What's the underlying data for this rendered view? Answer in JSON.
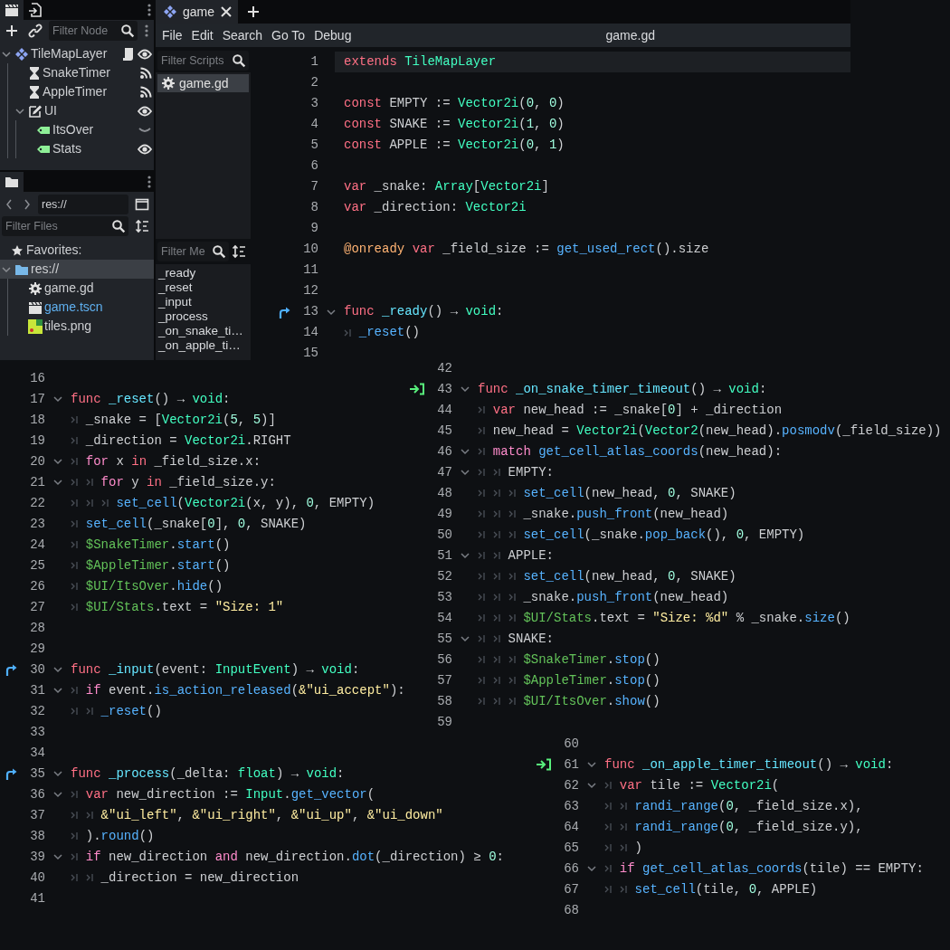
{
  "scene_dock": {
    "filter_placeholder": "Filter Node",
    "nodes": [
      {
        "name": "TileMapLayer",
        "kind": "tilemap",
        "expanded": true,
        "script": true,
        "signals": false,
        "visible": true,
        "children": [
          {
            "name": "SnakeTimer",
            "kind": "timer",
            "script": false,
            "signals": true
          },
          {
            "name": "AppleTimer",
            "kind": "timer",
            "script": false,
            "signals": true
          },
          {
            "name": "UI",
            "kind": "control",
            "expanded": true,
            "script": false,
            "signals": false,
            "visible": true,
            "children": [
              {
                "name": "ItsOver",
                "kind": "label",
                "script": false,
                "signals": false,
                "visible": false
              },
              {
                "name": "Stats",
                "kind": "label",
                "script": false,
                "signals": false,
                "visible": true
              }
            ]
          }
        ]
      }
    ]
  },
  "filesystem": {
    "path": "res://",
    "filter_placeholder": "Filter Files",
    "favorites_label": "Favorites:",
    "items": [
      {
        "name": "res://",
        "kind": "folder",
        "selected": true,
        "expanded": true,
        "current": false,
        "children": [
          {
            "name": "game.gd",
            "kind": "script",
            "selected": false,
            "current": false
          },
          {
            "name": "game.tscn",
            "kind": "scene",
            "selected": false,
            "current": true
          },
          {
            "name": "tiles.png",
            "kind": "image",
            "selected": false,
            "current": false
          }
        ]
      }
    ]
  },
  "script_editor": {
    "tabs": [
      {
        "label": "game",
        "selected": true
      }
    ],
    "menu": [
      "File",
      "Edit",
      "Search",
      "Go To",
      "Debug"
    ],
    "title": "game.gd",
    "scripts_filter_placeholder": "Filter Scripts",
    "scripts": [
      {
        "name": "game.gd",
        "selected": true
      }
    ],
    "methods_filter_placeholder": "Filter Me",
    "methods": [
      "_ready",
      "_reset",
      "_input",
      "_process",
      "_on_snake_ti…",
      "_on_apple_ti…"
    ]
  },
  "code_views": [
    {
      "lines": [
        {
          "n": "1",
          "fold": false,
          "current": true,
          "t": [
            {
              "kind": "kw",
              "text": "extends "
            },
            {
              "kind": "type",
              "text": "TileMapLayer"
            }
          ]
        },
        {
          "n": "2",
          "fold": false
        },
        {
          "n": "3",
          "fold": false,
          "t": [
            {
              "kind": "kw",
              "text": "const"
            },
            {
              "kind": "plain",
              "text": " EMPTY := "
            },
            {
              "kind": "type",
              "text": "Vector2i"
            },
            {
              "kind": "plain",
              "text": "("
            },
            {
              "kind": "num",
              "text": "0"
            },
            {
              "kind": "plain",
              "text": ", "
            },
            {
              "kind": "num",
              "text": "0"
            },
            {
              "kind": "plain",
              "text": ")"
            }
          ]
        },
        {
          "n": "4",
          "fold": false,
          "t": [
            {
              "kind": "kw",
              "text": "const"
            },
            {
              "kind": "plain",
              "text": " SNAKE := "
            },
            {
              "kind": "type",
              "text": "Vector2i"
            },
            {
              "kind": "plain",
              "text": "("
            },
            {
              "kind": "num",
              "text": "1"
            },
            {
              "kind": "plain",
              "text": ", "
            },
            {
              "kind": "num",
              "text": "0"
            },
            {
              "kind": "plain",
              "text": ")"
            }
          ]
        },
        {
          "n": "5",
          "fold": false,
          "t": [
            {
              "kind": "kw",
              "text": "const"
            },
            {
              "kind": "plain",
              "text": " APPLE := "
            },
            {
              "kind": "type",
              "text": "Vector2i"
            },
            {
              "kind": "plain",
              "text": "("
            },
            {
              "kind": "num",
              "text": "0"
            },
            {
              "kind": "plain",
              "text": ", "
            },
            {
              "kind": "num",
              "text": "1"
            },
            {
              "kind": "plain",
              "text": ")"
            }
          ]
        },
        {
          "n": "6",
          "fold": false
        },
        {
          "n": "7",
          "fold": false,
          "t": [
            {
              "kind": "kw",
              "text": "var"
            },
            {
              "kind": "plain",
              "text": " _snake: "
            },
            {
              "kind": "type",
              "text": "Array"
            },
            {
              "kind": "plain",
              "text": "["
            },
            {
              "kind": "type",
              "text": "Vector2i"
            },
            {
              "kind": "plain",
              "text": "]"
            }
          ]
        },
        {
          "n": "8",
          "fold": false,
          "t": [
            {
              "kind": "kw",
              "text": "var"
            },
            {
              "kind": "plain",
              "text": " _direction: "
            },
            {
              "kind": "type",
              "text": "Vector2i"
            }
          ]
        },
        {
          "n": "9",
          "fold": false
        },
        {
          "n": "10",
          "fold": false,
          "t": [
            {
              "kind": "annot",
              "text": "@onready "
            },
            {
              "kind": "kw",
              "text": "var"
            },
            {
              "kind": "plain",
              "text": " _field_size := "
            },
            {
              "kind": "call",
              "text": "get_used_rect"
            },
            {
              "kind": "plain",
              "text": "().size"
            }
          ]
        },
        {
          "n": "11",
          "fold": false
        },
        {
          "n": "12",
          "fold": false
        },
        {
          "n": "13",
          "fold": true,
          "gutter": {
            "kind": "override"
          },
          "t": [
            {
              "kind": "kw",
              "text": "func "
            },
            {
              "kind": "decl",
              "text": "_ready"
            },
            {
              "kind": "plain",
              "text": "() → "
            },
            {
              "kind": "type",
              "text": "void"
            },
            {
              "kind": "plain",
              "text": ":"
            }
          ]
        },
        {
          "n": "14",
          "fold": false,
          "t": [
            {
              "kind": "tab"
            },
            {
              "kind": "call",
              "text": "_reset"
            },
            {
              "kind": "plain",
              "text": "()"
            }
          ]
        },
        {
          "n": "15",
          "fold": false
        }
      ]
    },
    {
      "lines": [
        {
          "n": "16",
          "fold": false
        },
        {
          "n": "17",
          "fold": true,
          "t": [
            {
              "kind": "kw",
              "text": "func "
            },
            {
              "kind": "decl",
              "text": "_reset"
            },
            {
              "kind": "plain",
              "text": "() → "
            },
            {
              "kind": "type",
              "text": "void"
            },
            {
              "kind": "plain",
              "text": ":"
            }
          ]
        },
        {
          "n": "18",
          "fold": false,
          "t": [
            {
              "kind": "tab"
            },
            {
              "kind": "plain",
              "text": "_snake = ["
            },
            {
              "kind": "type",
              "text": "Vector2i"
            },
            {
              "kind": "plain",
              "text": "("
            },
            {
              "kind": "num",
              "text": "5"
            },
            {
              "kind": "plain",
              "text": ", "
            },
            {
              "kind": "num",
              "text": "5"
            },
            {
              "kind": "plain",
              "text": ")]"
            }
          ]
        },
        {
          "n": "19",
          "fold": false,
          "t": [
            {
              "kind": "tab"
            },
            {
              "kind": "plain",
              "text": "_direction = "
            },
            {
              "kind": "type",
              "text": "Vector2i"
            },
            {
              "kind": "plain",
              "text": ".RIGHT"
            }
          ]
        },
        {
          "n": "20",
          "fold": true,
          "t": [
            {
              "kind": "tab"
            },
            {
              "kind": "ctl",
              "text": "for"
            },
            {
              "kind": "plain",
              "text": " x "
            },
            {
              "kind": "kw",
              "text": "in"
            },
            {
              "kind": "plain",
              "text": " _field_size.x:"
            }
          ]
        },
        {
          "n": "21",
          "fold": true,
          "t": [
            {
              "kind": "tab"
            },
            {
              "kind": "tab"
            },
            {
              "kind": "ctl",
              "text": "for"
            },
            {
              "kind": "plain",
              "text": " y "
            },
            {
              "kind": "kw",
              "text": "in"
            },
            {
              "kind": "plain",
              "text": " _field_size.y:"
            }
          ]
        },
        {
          "n": "22",
          "fold": false,
          "t": [
            {
              "kind": "tab"
            },
            {
              "kind": "tab"
            },
            {
              "kind": "tab"
            },
            {
              "kind": "call",
              "text": "set_cell"
            },
            {
              "kind": "plain",
              "text": "("
            },
            {
              "kind": "type",
              "text": "Vector2i"
            },
            {
              "kind": "plain",
              "text": "(x, y), "
            },
            {
              "kind": "num",
              "text": "0"
            },
            {
              "kind": "plain",
              "text": ", EMPTY)"
            }
          ]
        },
        {
          "n": "23",
          "fold": false,
          "t": [
            {
              "kind": "tab"
            },
            {
              "kind": "call",
              "text": "set_cell"
            },
            {
              "kind": "plain",
              "text": "(_snake["
            },
            {
              "kind": "num",
              "text": "0"
            },
            {
              "kind": "plain",
              "text": "], "
            },
            {
              "kind": "num",
              "text": "0"
            },
            {
              "kind": "plain",
              "text": ", SNAKE)"
            }
          ]
        },
        {
          "n": "24",
          "fold": false,
          "t": [
            {
              "kind": "tab"
            },
            {
              "kind": "node",
              "text": "$SnakeTimer"
            },
            {
              "kind": "plain",
              "text": "."
            },
            {
              "kind": "call",
              "text": "start"
            },
            {
              "kind": "plain",
              "text": "()"
            }
          ]
        },
        {
          "n": "25",
          "fold": false,
          "t": [
            {
              "kind": "tab"
            },
            {
              "kind": "node",
              "text": "$AppleTimer"
            },
            {
              "kind": "plain",
              "text": "."
            },
            {
              "kind": "call",
              "text": "start"
            },
            {
              "kind": "plain",
              "text": "()"
            }
          ]
        },
        {
          "n": "26",
          "fold": false,
          "t": [
            {
              "kind": "tab"
            },
            {
              "kind": "node",
              "text": "$UI/ItsOver"
            },
            {
              "kind": "plain",
              "text": "."
            },
            {
              "kind": "call",
              "text": "hide"
            },
            {
              "kind": "plain",
              "text": "()"
            }
          ]
        },
        {
          "n": "27",
          "fold": false,
          "t": [
            {
              "kind": "tab"
            },
            {
              "kind": "node",
              "text": "$UI/Stats"
            },
            {
              "kind": "plain",
              "text": ".text = "
            },
            {
              "kind": "str",
              "text": "\"Size: 1\""
            }
          ]
        },
        {
          "n": "28",
          "fold": false
        },
        {
          "n": "29",
          "fold": false
        },
        {
          "n": "30",
          "fold": true,
          "gutter": {
            "kind": "override"
          },
          "t": [
            {
              "kind": "kw",
              "text": "func "
            },
            {
              "kind": "decl",
              "text": "_input"
            },
            {
              "kind": "plain",
              "text": "(event: "
            },
            {
              "kind": "type",
              "text": "InputEvent"
            },
            {
              "kind": "plain",
              "text": ") → "
            },
            {
              "kind": "type",
              "text": "void"
            },
            {
              "kind": "plain",
              "text": ":"
            }
          ]
        },
        {
          "n": "31",
          "fold": true,
          "t": [
            {
              "kind": "tab"
            },
            {
              "kind": "ctl",
              "text": "if"
            },
            {
              "kind": "plain",
              "text": " event."
            },
            {
              "kind": "call",
              "text": "is_action_released"
            },
            {
              "kind": "plain",
              "text": "("
            },
            {
              "kind": "str",
              "text": "&\"ui_accept\""
            },
            {
              "kind": "plain",
              "text": "):"
            }
          ]
        },
        {
          "n": "32",
          "fold": false,
          "t": [
            {
              "kind": "tab"
            },
            {
              "kind": "tab"
            },
            {
              "kind": "call",
              "text": "_reset"
            },
            {
              "kind": "plain",
              "text": "()"
            }
          ]
        },
        {
          "n": "33",
          "fold": false
        },
        {
          "n": "34",
          "fold": false
        },
        {
          "n": "35",
          "fold": true,
          "gutter": {
            "kind": "override"
          },
          "t": [
            {
              "kind": "kw",
              "text": "func "
            },
            {
              "kind": "decl",
              "text": "_process"
            },
            {
              "kind": "plain",
              "text": "(_delta: "
            },
            {
              "kind": "type",
              "text": "float"
            },
            {
              "kind": "plain",
              "text": ") → "
            },
            {
              "kind": "type",
              "text": "void"
            },
            {
              "kind": "plain",
              "text": ":"
            }
          ]
        },
        {
          "n": "36",
          "fold": true,
          "t": [
            {
              "kind": "tab"
            },
            {
              "kind": "kw",
              "text": "var"
            },
            {
              "kind": "plain",
              "text": " new_direction := "
            },
            {
              "kind": "type",
              "text": "Input"
            },
            {
              "kind": "plain",
              "text": "."
            },
            {
              "kind": "call",
              "text": "get_vector"
            },
            {
              "kind": "plain",
              "text": "("
            }
          ]
        },
        {
          "n": "37",
          "fold": false,
          "t": [
            {
              "kind": "tab"
            },
            {
              "kind": "tab"
            },
            {
              "kind": "str",
              "text": "&\"ui_left\""
            },
            {
              "kind": "plain",
              "text": ", "
            },
            {
              "kind": "str",
              "text": "&\"ui_right\""
            },
            {
              "kind": "plain",
              "text": ", "
            },
            {
              "kind": "str",
              "text": "&\"ui_up\""
            },
            {
              "kind": "plain",
              "text": ", "
            },
            {
              "kind": "str",
              "text": "&\"ui_down\""
            }
          ]
        },
        {
          "n": "38",
          "fold": false,
          "t": [
            {
              "kind": "tab"
            },
            {
              "kind": "plain",
              "text": ")."
            },
            {
              "kind": "call",
              "text": "round"
            },
            {
              "kind": "plain",
              "text": "()"
            }
          ]
        },
        {
          "n": "39",
          "fold": true,
          "t": [
            {
              "kind": "tab"
            },
            {
              "kind": "ctl",
              "text": "if"
            },
            {
              "kind": "plain",
              "text": " new_direction "
            },
            {
              "kind": "ctl",
              "text": "and"
            },
            {
              "kind": "plain",
              "text": " new_direction."
            },
            {
              "kind": "call",
              "text": "dot"
            },
            {
              "kind": "plain",
              "text": "(_direction) ≥ "
            },
            {
              "kind": "num",
              "text": "0"
            },
            {
              "kind": "plain",
              "text": ":"
            }
          ]
        },
        {
          "n": "40",
          "fold": false,
          "t": [
            {
              "kind": "tab"
            },
            {
              "kind": "tab"
            },
            {
              "kind": "plain",
              "text": "_direction = new_direction"
            }
          ]
        },
        {
          "n": "41",
          "fold": false
        }
      ]
    },
    {
      "lines": [
        {
          "n": "42",
          "fold": false
        },
        {
          "n": "43",
          "fold": true,
          "gutter": {
            "kind": "signal"
          },
          "t": [
            {
              "kind": "kw",
              "text": "func "
            },
            {
              "kind": "decl",
              "text": "_on_snake_timer_timeout"
            },
            {
              "kind": "plain",
              "text": "() → "
            },
            {
              "kind": "type",
              "text": "void"
            },
            {
              "kind": "plain",
              "text": ":"
            }
          ]
        },
        {
          "n": "44",
          "fold": false,
          "t": [
            {
              "kind": "tab"
            },
            {
              "kind": "kw",
              "text": "var"
            },
            {
              "kind": "plain",
              "text": " new_head := _snake["
            },
            {
              "kind": "num",
              "text": "0"
            },
            {
              "kind": "plain",
              "text": "] + _direction"
            }
          ]
        },
        {
          "n": "45",
          "fold": false,
          "t": [
            {
              "kind": "tab"
            },
            {
              "kind": "plain",
              "text": "new_head = "
            },
            {
              "kind": "type",
              "text": "Vector2i"
            },
            {
              "kind": "plain",
              "text": "("
            },
            {
              "kind": "type",
              "text": "Vector2"
            },
            {
              "kind": "plain",
              "text": "(new_head)."
            },
            {
              "kind": "call",
              "text": "posmodv"
            },
            {
              "kind": "plain",
              "text": "(_field_size))"
            }
          ]
        },
        {
          "n": "46",
          "fold": true,
          "t": [
            {
              "kind": "tab"
            },
            {
              "kind": "ctl",
              "text": "match "
            },
            {
              "kind": "call",
              "text": "get_cell_atlas_coords"
            },
            {
              "kind": "plain",
              "text": "(new_head):"
            }
          ]
        },
        {
          "n": "47",
          "fold": true,
          "t": [
            {
              "kind": "tab"
            },
            {
              "kind": "tab"
            },
            {
              "kind": "plain",
              "text": "EMPTY:"
            }
          ]
        },
        {
          "n": "48",
          "fold": false,
          "t": [
            {
              "kind": "tab"
            },
            {
              "kind": "tab"
            },
            {
              "kind": "tab"
            },
            {
              "kind": "call",
              "text": "set_cell"
            },
            {
              "kind": "plain",
              "text": "(new_head, "
            },
            {
              "kind": "num",
              "text": "0"
            },
            {
              "kind": "plain",
              "text": ", SNAKE)"
            }
          ]
        },
        {
          "n": "49",
          "fold": false,
          "t": [
            {
              "kind": "tab"
            },
            {
              "kind": "tab"
            },
            {
              "kind": "tab"
            },
            {
              "kind": "plain",
              "text": "_snake."
            },
            {
              "kind": "call",
              "text": "push_front"
            },
            {
              "kind": "plain",
              "text": "(new_head)"
            }
          ]
        },
        {
          "n": "50",
          "fold": false,
          "t": [
            {
              "kind": "tab"
            },
            {
              "kind": "tab"
            },
            {
              "kind": "tab"
            },
            {
              "kind": "call",
              "text": "set_cell"
            },
            {
              "kind": "plain",
              "text": "(_snake."
            },
            {
              "kind": "call",
              "text": "pop_back"
            },
            {
              "kind": "plain",
              "text": "(), "
            },
            {
              "kind": "num",
              "text": "0"
            },
            {
              "kind": "plain",
              "text": ", EMPTY)"
            }
          ]
        },
        {
          "n": "51",
          "fold": true,
          "t": [
            {
              "kind": "tab"
            },
            {
              "kind": "tab"
            },
            {
              "kind": "plain",
              "text": "APPLE:"
            }
          ]
        },
        {
          "n": "52",
          "fold": false,
          "t": [
            {
              "kind": "tab"
            },
            {
              "kind": "tab"
            },
            {
              "kind": "tab"
            },
            {
              "kind": "call",
              "text": "set_cell"
            },
            {
              "kind": "plain",
              "text": "(new_head, "
            },
            {
              "kind": "num",
              "text": "0"
            },
            {
              "kind": "plain",
              "text": ", SNAKE)"
            }
          ]
        },
        {
          "n": "53",
          "fold": false,
          "t": [
            {
              "kind": "tab"
            },
            {
              "kind": "tab"
            },
            {
              "kind": "tab"
            },
            {
              "kind": "plain",
              "text": "_snake."
            },
            {
              "kind": "call",
              "text": "push_front"
            },
            {
              "kind": "plain",
              "text": "(new_head)"
            }
          ]
        },
        {
          "n": "54",
          "fold": false,
          "t": [
            {
              "kind": "tab"
            },
            {
              "kind": "tab"
            },
            {
              "kind": "tab"
            },
            {
              "kind": "node",
              "text": "$UI/Stats"
            },
            {
              "kind": "plain",
              "text": ".text = "
            },
            {
              "kind": "str",
              "text": "\"Size: %d\""
            },
            {
              "kind": "plain",
              "text": " % _snake."
            },
            {
              "kind": "call",
              "text": "size"
            },
            {
              "kind": "plain",
              "text": "()"
            }
          ]
        },
        {
          "n": "55",
          "fold": true,
          "t": [
            {
              "kind": "tab"
            },
            {
              "kind": "tab"
            },
            {
              "kind": "plain",
              "text": "SNAKE:"
            }
          ]
        },
        {
          "n": "56",
          "fold": false,
          "t": [
            {
              "kind": "tab"
            },
            {
              "kind": "tab"
            },
            {
              "kind": "tab"
            },
            {
              "kind": "node",
              "text": "$SnakeTimer"
            },
            {
              "kind": "plain",
              "text": "."
            },
            {
              "kind": "call",
              "text": "stop"
            },
            {
              "kind": "plain",
              "text": "()"
            }
          ]
        },
        {
          "n": "57",
          "fold": false,
          "t": [
            {
              "kind": "tab"
            },
            {
              "kind": "tab"
            },
            {
              "kind": "tab"
            },
            {
              "kind": "node",
              "text": "$AppleTimer"
            },
            {
              "kind": "plain",
              "text": "."
            },
            {
              "kind": "call",
              "text": "stop"
            },
            {
              "kind": "plain",
              "text": "()"
            }
          ]
        },
        {
          "n": "58",
          "fold": false,
          "t": [
            {
              "kind": "tab"
            },
            {
              "kind": "tab"
            },
            {
              "kind": "tab"
            },
            {
              "kind": "node",
              "text": "$UI/ItsOver"
            },
            {
              "kind": "plain",
              "text": "."
            },
            {
              "kind": "call",
              "text": "show"
            },
            {
              "kind": "plain",
              "text": "()"
            }
          ]
        },
        {
          "n": "59",
          "fold": false
        }
      ]
    },
    {
      "lines": [
        {
          "n": "60",
          "fold": false
        },
        {
          "n": "61",
          "fold": true,
          "gutter": {
            "kind": "signal"
          },
          "t": [
            {
              "kind": "kw",
              "text": "func "
            },
            {
              "kind": "decl",
              "text": "_on_apple_timer_timeout"
            },
            {
              "kind": "plain",
              "text": "() → "
            },
            {
              "kind": "type",
              "text": "void"
            },
            {
              "kind": "plain",
              "text": ":"
            }
          ]
        },
        {
          "n": "62",
          "fold": true,
          "t": [
            {
              "kind": "tab"
            },
            {
              "kind": "kw",
              "text": "var"
            },
            {
              "kind": "plain",
              "text": " tile := "
            },
            {
              "kind": "type",
              "text": "Vector2i"
            },
            {
              "kind": "plain",
              "text": "("
            }
          ]
        },
        {
          "n": "63",
          "fold": false,
          "t": [
            {
              "kind": "tab"
            },
            {
              "kind": "tab"
            },
            {
              "kind": "call",
              "text": "randi_range"
            },
            {
              "kind": "plain",
              "text": "("
            },
            {
              "kind": "num",
              "text": "0"
            },
            {
              "kind": "plain",
              "text": ", _field_size.x),"
            }
          ]
        },
        {
          "n": "64",
          "fold": false,
          "t": [
            {
              "kind": "tab"
            },
            {
              "kind": "tab"
            },
            {
              "kind": "call",
              "text": "randi_range"
            },
            {
              "kind": "plain",
              "text": "("
            },
            {
              "kind": "num",
              "text": "0"
            },
            {
              "kind": "plain",
              "text": ", _field_size.y),"
            }
          ]
        },
        {
          "n": "65",
          "fold": false,
          "t": [
            {
              "kind": "tab"
            },
            {
              "kind": "tab"
            },
            {
              "kind": "plain",
              "text": ")"
            }
          ]
        },
        {
          "n": "66",
          "fold": true,
          "t": [
            {
              "kind": "tab"
            },
            {
              "kind": "ctl",
              "text": "if "
            },
            {
              "kind": "call",
              "text": "get_cell_atlas_coords"
            },
            {
              "kind": "plain",
              "text": "(tile) == EMPTY:"
            }
          ]
        },
        {
          "n": "67",
          "fold": false,
          "t": [
            {
              "kind": "tab"
            },
            {
              "kind": "tab"
            },
            {
              "kind": "call",
              "text": "set_cell"
            },
            {
              "kind": "plain",
              "text": "(tile, "
            },
            {
              "kind": "num",
              "text": "0"
            },
            {
              "kind": "plain",
              "text": ", APPLE)"
            }
          ]
        },
        {
          "n": "68",
          "fold": false
        }
      ]
    }
  ]
}
